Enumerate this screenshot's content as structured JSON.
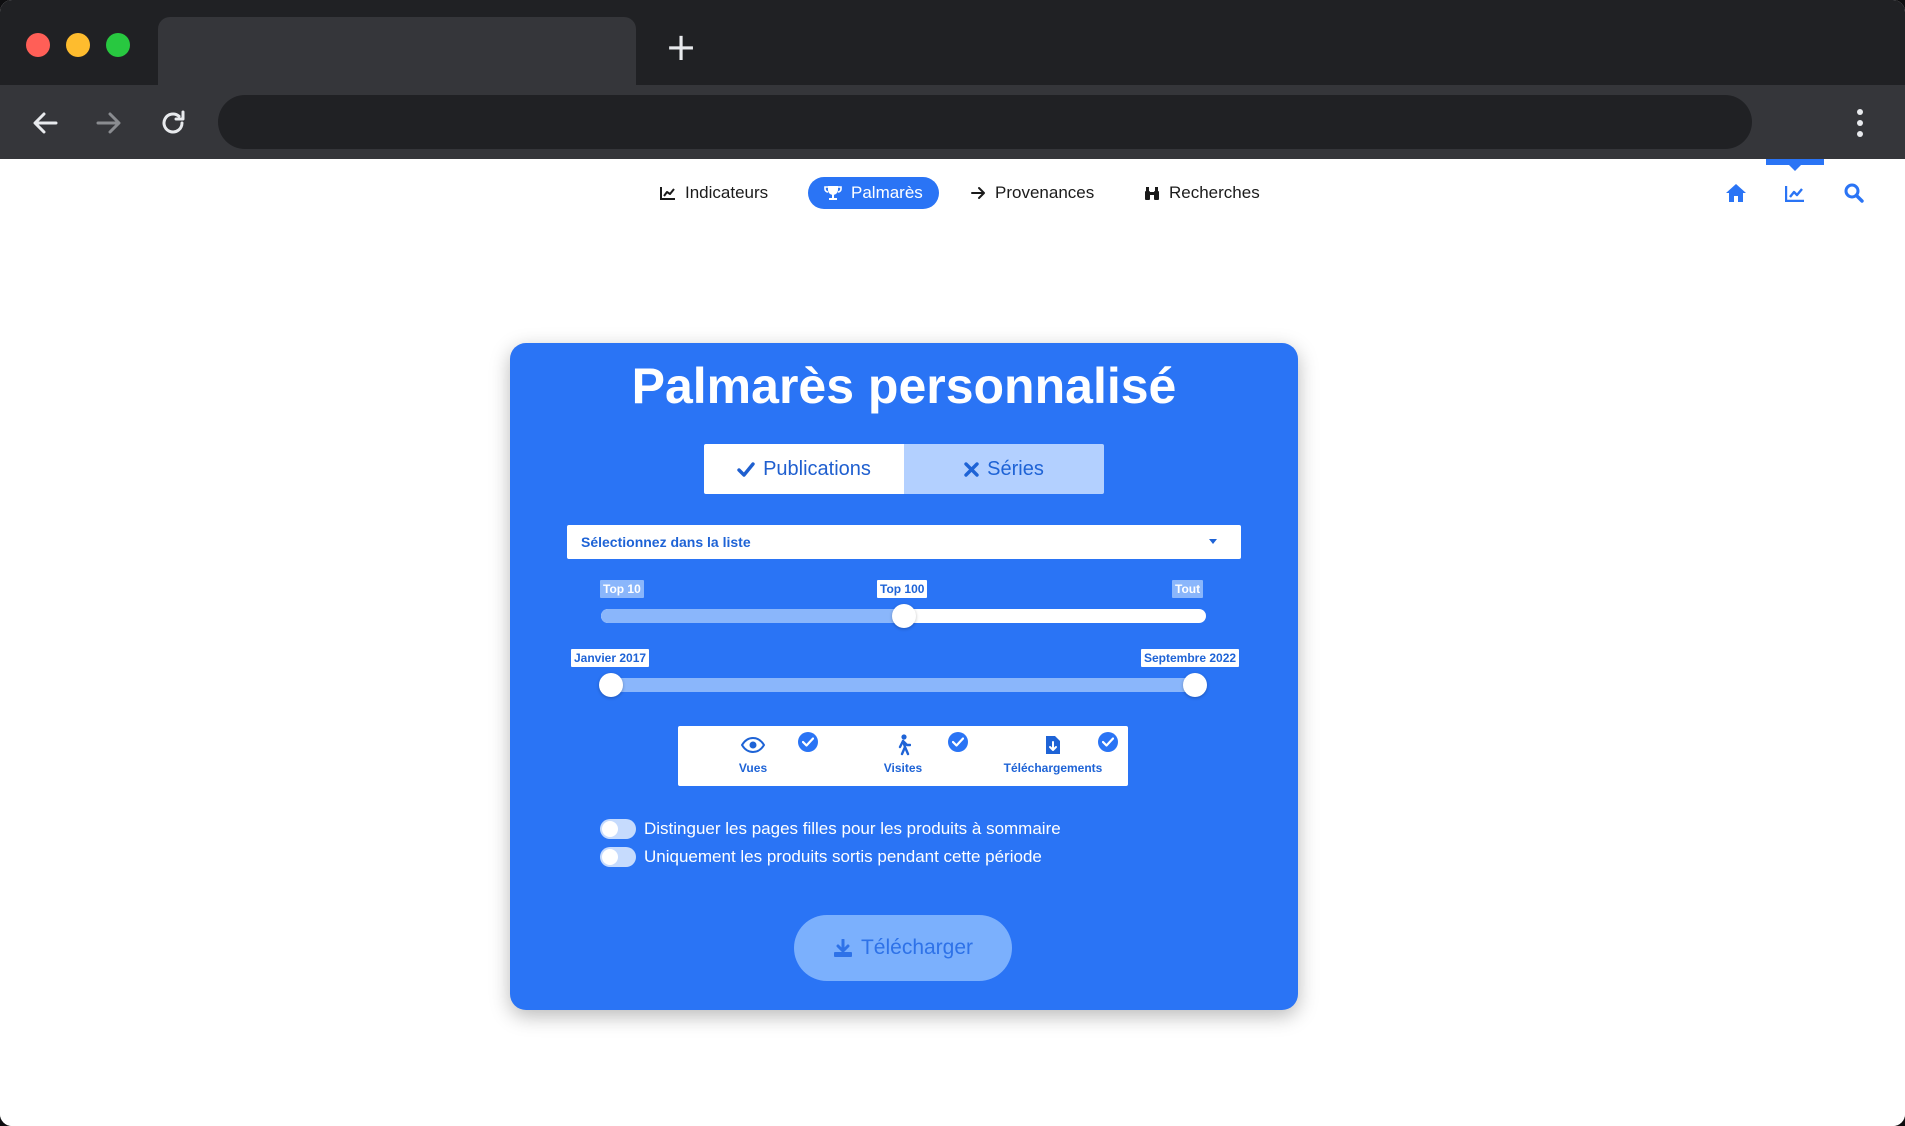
{
  "browser": {
    "new_tab_symbol": "+"
  },
  "nav": {
    "items": [
      {
        "label": "Indicateurs",
        "icon": "line-chart-icon"
      },
      {
        "label": "Palmarès",
        "icon": "trophy-icon"
      },
      {
        "label": "Provenances",
        "icon": "arrow-right-icon"
      },
      {
        "label": "Recherches",
        "icon": "binoculars-icon"
      }
    ],
    "active": "Palmarès",
    "right_icons": [
      "home-icon",
      "line-chart-icon",
      "search-icon"
    ]
  },
  "card": {
    "title": "Palmarès personnalisé",
    "segment": {
      "publications": "Publications",
      "series": "Séries",
      "selected": "Publications"
    },
    "select_placeholder": "Sélectionnez dans la liste",
    "rank_slider": {
      "labels": [
        "Top 10",
        "Top 100",
        "Tout"
      ],
      "selected": "Top 100"
    },
    "date_slider": {
      "start": "Janvier 2017",
      "end": "Septembre 2022"
    },
    "metrics": [
      {
        "label": "Vues",
        "icon": "eye-icon",
        "checked": true
      },
      {
        "label": "Visites",
        "icon": "walking-icon",
        "checked": true
      },
      {
        "label": "Téléchargements",
        "icon": "file-download-icon",
        "checked": true
      }
    ],
    "toggles": [
      {
        "label": "Distinguer les pages filles pour les produits à sommaire",
        "on": false
      },
      {
        "label": "Uniquement les produits sortis pendant cette période",
        "on": false
      }
    ],
    "download_label": "Télécharger"
  },
  "colors": {
    "accent": "#2a74f5",
    "chrome_dark": "#202124",
    "chrome_toolbar": "#35363a"
  }
}
